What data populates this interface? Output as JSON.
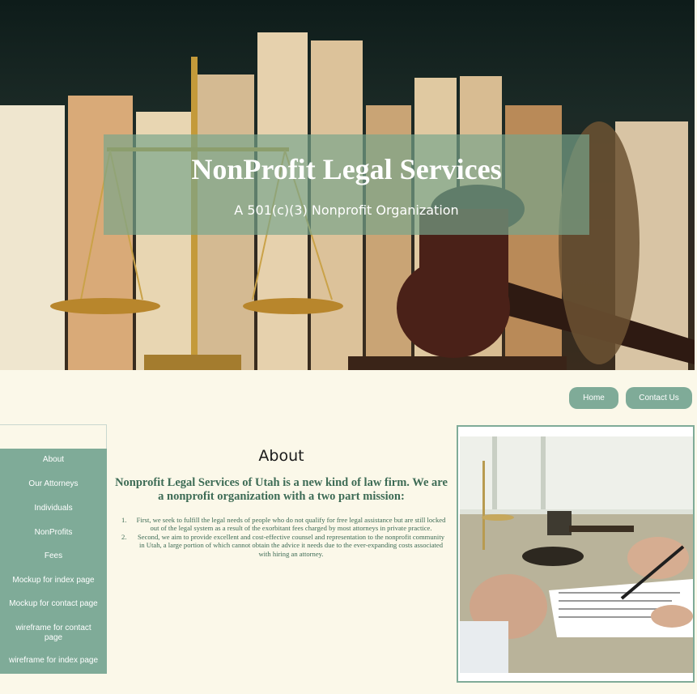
{
  "hero": {
    "title": "NonProfit Legal Services",
    "subtitle": "A 501(c)(3) Nonprofit Organization"
  },
  "nav": {
    "home": "Home",
    "contact": "Contact Us"
  },
  "sidebar": {
    "items": [
      {
        "label": "About"
      },
      {
        "label": "Our Attorneys"
      },
      {
        "label": "Individuals"
      },
      {
        "label": "NonProfits"
      },
      {
        "label": "Fees"
      },
      {
        "label": "Mockup for index page"
      },
      {
        "label": "Mockup for contact page"
      },
      {
        "label": "wireframe for contact page"
      },
      {
        "label": "wireframe for index page"
      }
    ]
  },
  "about": {
    "heading": "About",
    "mission": "Nonprofit Legal Services of Utah is a new kind of law firm. We are a nonprofit organization with a two part mission:",
    "points": [
      {
        "num": "1.",
        "text": "First, we seek to fulfill the legal needs of people who do not qualify for free legal assistance but are still locked out of the legal system as a result of the exorbitant fees charged by most attorneys in private practice."
      },
      {
        "num": "2.",
        "text": "Second, we aim to provide excellent and cost-effective counsel and representation to the nonprofit community in Utah, a large portion of which cannot obtain the advice it needs due to the ever-expanding costs associated with hiring an attorney."
      }
    ]
  },
  "colors": {
    "accent": "#7fab98",
    "background": "#fbf8e9",
    "text_green": "#3d6b55"
  },
  "icons": {
    "hero_image": "scales-books-gavel-image",
    "side_image": "lawyer-gavel-desk-image"
  }
}
